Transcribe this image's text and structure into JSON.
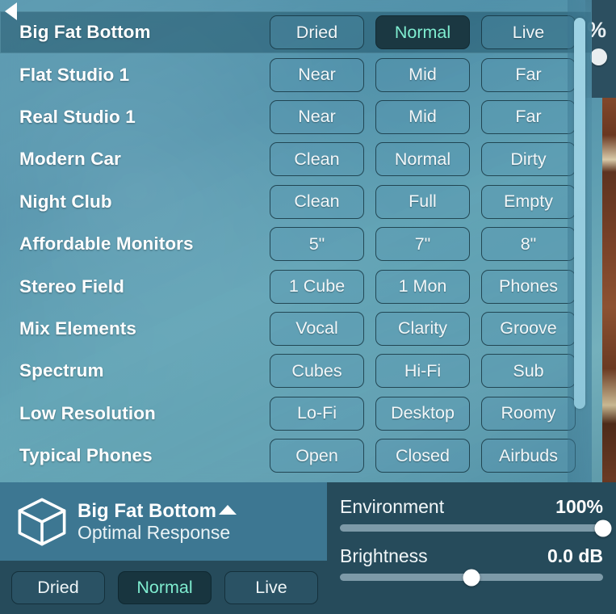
{
  "background": {
    "partial_slider": {
      "unit_label": "%",
      "knob_icon": "slider-knob"
    }
  },
  "preset_list": {
    "scrollbar": {
      "arrow_icon": "scroll-up-arrow-icon"
    },
    "rows": [
      {
        "name": "Big Fat Bottom",
        "selected": true,
        "options": [
          "Dried",
          "Normal",
          "Live"
        ],
        "active_index": 1
      },
      {
        "name": "Flat Studio 1",
        "selected": false,
        "options": [
          "Near",
          "Mid",
          "Far"
        ],
        "active_index": -1
      },
      {
        "name": "Real Studio 1",
        "selected": false,
        "options": [
          "Near",
          "Mid",
          "Far"
        ],
        "active_index": -1
      },
      {
        "name": "Modern Car",
        "selected": false,
        "options": [
          "Clean",
          "Normal",
          "Dirty"
        ],
        "active_index": -1
      },
      {
        "name": "Night Club",
        "selected": false,
        "options": [
          "Clean",
          "Full",
          "Empty"
        ],
        "active_index": -1
      },
      {
        "name": "Affordable Monitors",
        "selected": false,
        "options": [
          "5\"",
          "7\"",
          "8\""
        ],
        "active_index": -1
      },
      {
        "name": "Stereo Field",
        "selected": false,
        "options": [
          "1 Cube",
          "1 Mon",
          "Phones"
        ],
        "active_index": -1
      },
      {
        "name": "Mix Elements",
        "selected": false,
        "options": [
          "Vocal",
          "Clarity",
          "Groove"
        ],
        "active_index": -1
      },
      {
        "name": "Spectrum",
        "selected": false,
        "options": [
          "Cubes",
          "Hi-Fi",
          "Sub"
        ],
        "active_index": -1
      },
      {
        "name": "Low Resolution",
        "selected": false,
        "options": [
          "Lo-Fi",
          "Desktop",
          "Roomy"
        ],
        "active_index": -1
      },
      {
        "name": "Typical Phones",
        "selected": false,
        "options": [
          "Open",
          "Closed",
          "Airbuds"
        ],
        "active_index": -1
      }
    ]
  },
  "footer": {
    "current_preset": {
      "icon": "cube-icon",
      "title": "Big Fat Bottom",
      "subtitle": "Optimal Response",
      "collapse_icon": "chevron-up-icon"
    },
    "variant_buttons": {
      "options": [
        "Dried",
        "Normal",
        "Live"
      ],
      "active_index": 1
    },
    "sliders": [
      {
        "label": "Environment",
        "value": "100%",
        "percent": 100
      },
      {
        "label": "Brightness",
        "value": "0.0 dB",
        "percent": 50
      }
    ]
  },
  "colors": {
    "accent_mint": "#7fedd0",
    "panel_dark": "#264b5b",
    "header_blue": "#3d7792",
    "selected_button_bg": "#1b3842",
    "scrollbar_thumb": "#9fd3e4"
  }
}
